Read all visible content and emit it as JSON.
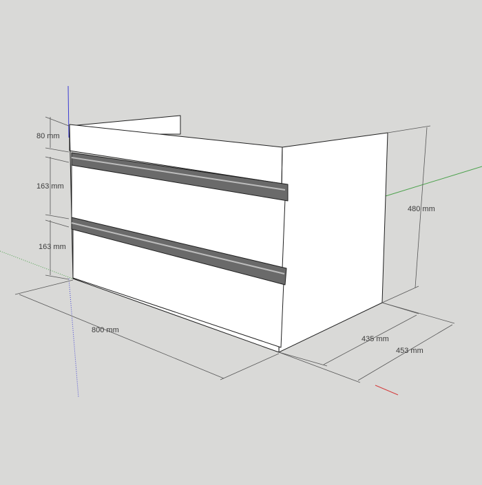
{
  "scene": {
    "background": "#d9d9d7",
    "object": "two-drawer vanity cabinet",
    "face_color": "#ffffff",
    "edge_color": "#1e1e1e",
    "handle_color": "#5a5a5a"
  },
  "axes": {
    "red": "#d43b3b",
    "green": "#4aa14a",
    "blue": "#3b3bd4"
  },
  "dimensions": {
    "top_gap": "80 mm",
    "drawer_upper": "163 mm",
    "drawer_lower": "163 mm",
    "width": "800 mm",
    "height": "480 mm",
    "depth_inner": "435 mm",
    "depth_outer": "453 mm"
  }
}
